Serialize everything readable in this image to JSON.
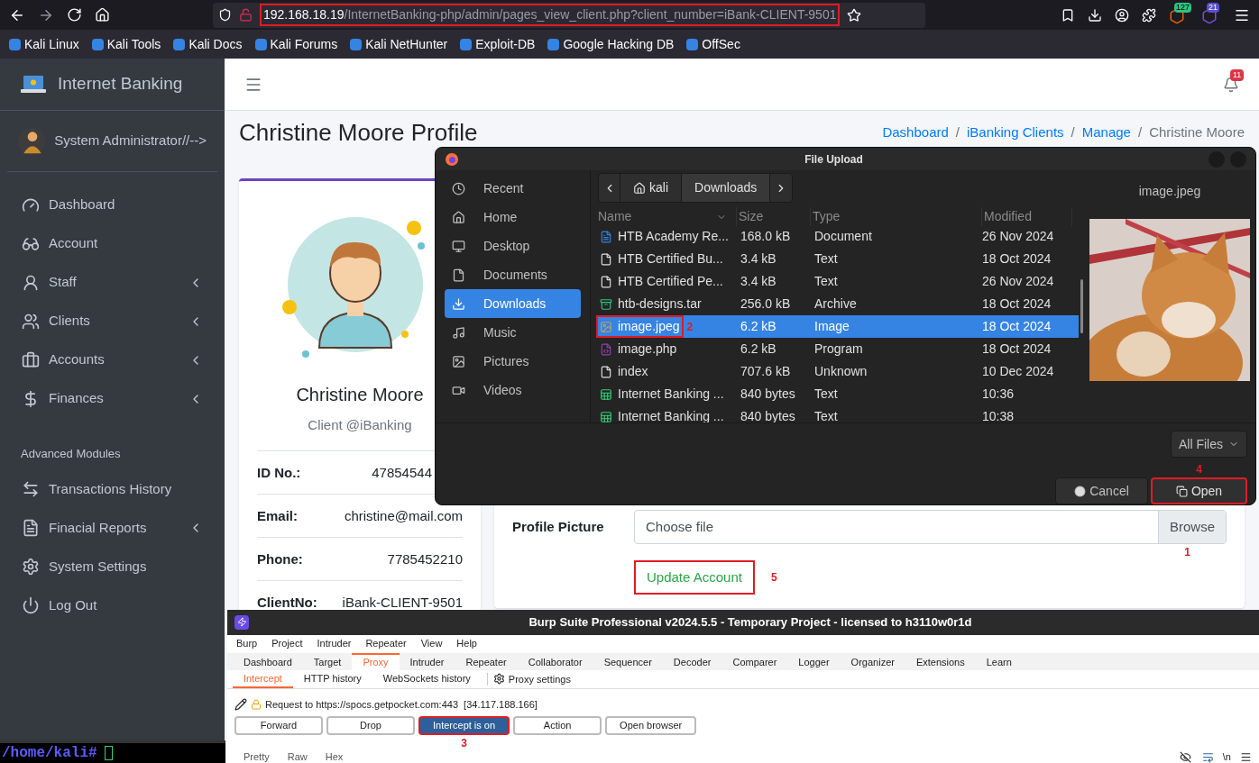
{
  "browser": {
    "url_host": "192.168.18.19",
    "url_path": "/InternetBanking-php/admin/pages_view_client.php?client_number=iBank-CLIENT-9501",
    "url_highlighted": true,
    "badges": [
      "127",
      "21"
    ],
    "bookmarks": [
      "Kali Linux",
      "Kali Tools",
      "Kali Docs",
      "Kali Forums",
      "Kali NetHunter",
      "Exploit-DB",
      "Google Hacking DB",
      "OffSec"
    ]
  },
  "sidebar": {
    "brand": "Internet Banking",
    "user": "System Administrator//-->",
    "items": [
      {
        "label": "Dashboard",
        "expandable": false
      },
      {
        "label": "Account",
        "expandable": false
      },
      {
        "label": "Staff",
        "expandable": true
      },
      {
        "label": "Clients",
        "expandable": true
      },
      {
        "label": "Accounts",
        "expandable": true
      },
      {
        "label": "Finances",
        "expandable": true
      }
    ],
    "section": "Advanced Modules",
    "advanced_items": [
      {
        "label": "Transactions History",
        "expandable": false
      },
      {
        "label": "Finacial Reports",
        "expandable": true
      },
      {
        "label": "System Settings",
        "expandable": false
      },
      {
        "label": "Log Out",
        "expandable": false
      }
    ]
  },
  "topbar": {
    "notifications": "11"
  },
  "page": {
    "title": "Christine Moore Profile",
    "breadcrumbs": [
      {
        "label": "Dashboard",
        "link": true
      },
      {
        "separator": "/",
        "label": "iBanking Clients",
        "link": true
      },
      {
        "separator": "/",
        "label": "Manage",
        "link": true
      },
      {
        "separator": "/",
        "label": "Christine Moore",
        "link": false
      }
    ]
  },
  "profile": {
    "name": "Christine Moore",
    "role": "Client @iBanking",
    "fields": [
      {
        "label": "ID No.:",
        "value": "47854544",
        "clipped": true
      },
      {
        "label": "Email:",
        "value": "christine@mail.com"
      },
      {
        "label": "Phone:",
        "value": "7785452210"
      },
      {
        "label": "ClientNo:",
        "value": "iBank-CLIENT-9501"
      }
    ]
  },
  "form": {
    "label": "Profile Picture",
    "placeholder": "Choose file",
    "browse": "Browse",
    "browse_callout": "1",
    "submit": "Update Account",
    "submit_highlighted": true,
    "submit_callout": "5"
  },
  "file_dialog": {
    "title": "File Upload",
    "places": [
      {
        "label": "Recent",
        "selected": false
      },
      {
        "label": "Home",
        "selected": false
      },
      {
        "label": "Desktop",
        "selected": false
      },
      {
        "label": "Documents",
        "selected": false
      },
      {
        "label": "Downloads",
        "selected": true
      },
      {
        "label": "Music",
        "selected": false
      },
      {
        "label": "Pictures",
        "selected": false
      },
      {
        "label": "Videos",
        "selected": false
      }
    ],
    "path": [
      "kali",
      "Downloads"
    ],
    "columns": [
      "Name",
      "Size",
      "Type",
      "Modified"
    ],
    "files": [
      {
        "name": "HTB Academy Re...",
        "size": "168.0 kB",
        "type": "Document",
        "modified": "26 Nov 2024",
        "kind": "document",
        "selected": false
      },
      {
        "name": "HTB Certified Bu...",
        "size": "3.4 kB",
        "type": "Text",
        "modified": "18 Oct 2024",
        "kind": "text",
        "selected": false
      },
      {
        "name": "HTB Certified Pe...",
        "size": "3.4 kB",
        "type": "Text",
        "modified": "26 Nov 2024",
        "kind": "text",
        "selected": false
      },
      {
        "name": "htb-designs.tar",
        "size": "256.0 kB",
        "type": "Archive",
        "modified": "18 Oct 2024",
        "kind": "archive",
        "selected": false
      },
      {
        "name": "image.jpeg",
        "size": "6.2 kB",
        "type": "Image",
        "modified": "18 Oct 2024",
        "selected": true,
        "highlighted": true,
        "callout": "2"
      },
      {
        "name": "image.php",
        "size": "6.2 kB",
        "type": "Program",
        "modified": "18 Oct 2024",
        "kind": "program",
        "selected": false
      },
      {
        "name": "index",
        "size": "707.6 kB",
        "type": "Unknown",
        "modified": "10 Dec 2024",
        "kind": "text",
        "selected": false
      },
      {
        "name": "Internet Banking ...",
        "size": "840 bytes",
        "type": "Text",
        "modified": "10:36",
        "kind": "sheet",
        "selected": false
      },
      {
        "name": "Internet Banking ...",
        "size": "840 bytes",
        "type": "Text",
        "modified": "10:38",
        "kind": "sheet",
        "selected": false
      }
    ],
    "preview_title": "image.jpeg",
    "filter": "All Files",
    "cancel": "Cancel",
    "open": "Open",
    "open_highlighted": true,
    "open_callout": "4"
  },
  "burp": {
    "title": "Burp Suite Professional v2024.5.5 - Temporary Project - licensed to h3110w0r1d",
    "menu": [
      "Burp",
      "Project",
      "Intruder",
      "Repeater",
      "View",
      "Help"
    ],
    "tabs": [
      {
        "label": "Dashboard",
        "selected": false
      },
      {
        "label": "Target",
        "selected": false
      },
      {
        "label": "Proxy",
        "selected": true
      },
      {
        "label": "Intruder",
        "selected": false
      },
      {
        "label": "Repeater",
        "selected": false
      },
      {
        "label": "Collaborator",
        "selected": false
      },
      {
        "label": "Sequencer",
        "selected": false
      },
      {
        "label": "Decoder",
        "selected": false
      },
      {
        "label": "Comparer",
        "selected": false
      },
      {
        "label": "Logger",
        "selected": false
      },
      {
        "label": "Organizer",
        "selected": false
      },
      {
        "label": "Extensions",
        "selected": false
      },
      {
        "label": "Learn",
        "selected": false
      }
    ],
    "subtabs": [
      {
        "label": "Intercept",
        "selected": true
      },
      {
        "label": "HTTP history",
        "selected": false
      },
      {
        "label": "WebSockets history",
        "selected": false
      }
    ],
    "settings": "Proxy settings",
    "request": "Request to https://spocs.getpocket.com:443  [34.117.188.166]",
    "buttons": [
      {
        "label": "Forward",
        "selected": false
      },
      {
        "label": "Drop",
        "selected": false
      },
      {
        "label": "Intercept is on",
        "selected": true,
        "highlighted": true,
        "callout": "3"
      },
      {
        "label": "Action",
        "selected": false
      },
      {
        "label": "Open browser",
        "selected": false
      }
    ],
    "views": [
      "Pretty",
      "Raw",
      "Hex"
    ],
    "newline": "\\n"
  },
  "terminal": {
    "prompt": "/home/kali#"
  }
}
